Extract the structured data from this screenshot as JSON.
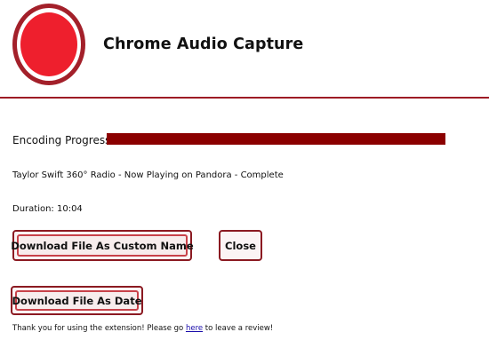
{
  "header": {
    "title": "Chrome Audio Capture",
    "logo_icon": "record-icon",
    "logo_outer_color": "#a3202a",
    "logo_inner_color": "#ee1f2d",
    "rule_color": "#9e1b25"
  },
  "progress": {
    "label": "Encoding Progress:",
    "value_fraction": 1.0,
    "bar_color": "#8b0000"
  },
  "file": {
    "status": "Taylor Swift 360° Radio - Now Playing on Pandora - Complete",
    "duration": "Duration: 10:04"
  },
  "buttons": {
    "download_custom": "Download File As Custom Name",
    "close": "Close",
    "download_date": "Download File As Date"
  },
  "footer": {
    "prefix": "Thank you for using the extension! Please go ",
    "link": "here",
    "suffix": " to leave a review!"
  }
}
